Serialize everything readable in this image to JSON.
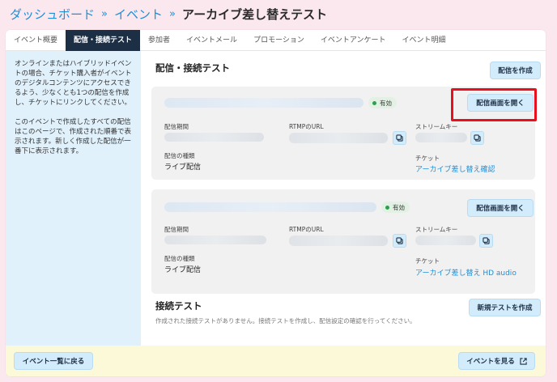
{
  "breadcrumb": {
    "dashboard": "ダッシュボード",
    "event": "イベント",
    "separator": "»",
    "current": "アーカイブ差し替えテスト"
  },
  "tabs": [
    {
      "label": "イベント概要"
    },
    {
      "label": "配信・接続テスト",
      "active": true
    },
    {
      "label": "参加者"
    },
    {
      "label": "イベントメール"
    },
    {
      "label": "プロモーション"
    },
    {
      "label": "イベントアンケート"
    },
    {
      "label": "イベント明細"
    }
  ],
  "sidebar": {
    "paragraph1": "オンラインまたはハイブリッドイベントの場合、チケット購入者がイベントのデジタルコンテンツにアクセスできるよう、少なくとも1つの配信を作成し、チケットにリンクしてください。",
    "paragraph2": "このイベントで作成したすべての配信はこのページで、作成された順番で表示されます。新しく作成した配信が一番下に表示されます。"
  },
  "streams_section": {
    "title": "配信・接続テスト",
    "create_button": "配信を作成",
    "cards": [
      {
        "status": "有効",
        "open_button": "配信画面を開く",
        "period_label": "配信期間",
        "rtmp_label": "RTMPのURL",
        "stream_key_label": "ストリームキー",
        "type_label": "配信の種類",
        "type_value": "ライブ配信",
        "ticket_label": "チケット",
        "ticket_link": "アーカイブ差し替え確認"
      },
      {
        "status": "有効",
        "open_button": "配信画面を開く",
        "period_label": "配信期間",
        "rtmp_label": "RTMPのURL",
        "stream_key_label": "ストリームキー",
        "type_label": "配信の種類",
        "type_value": "ライブ配信",
        "ticket_label": "チケット",
        "ticket_link": "アーカイブ差し替え HD audio"
      }
    ]
  },
  "connection_test": {
    "title": "接続テスト",
    "new_button": "新規テストを作成",
    "empty_message": "作成された接続テストがありません。接続テストを作成し、配信設定の確認を行ってください。"
  },
  "footer": {
    "back_button": "イベント一覧に戻る",
    "view_button": "イベントを見る"
  },
  "colors": {
    "page_bg": "#fbe8ee",
    "active_tab": "#1c2f45",
    "sidebar_bg": "#e1f1fb",
    "link": "#1e8fd8",
    "highlight": "#e8101e",
    "status_dot": "#2aa14a"
  }
}
